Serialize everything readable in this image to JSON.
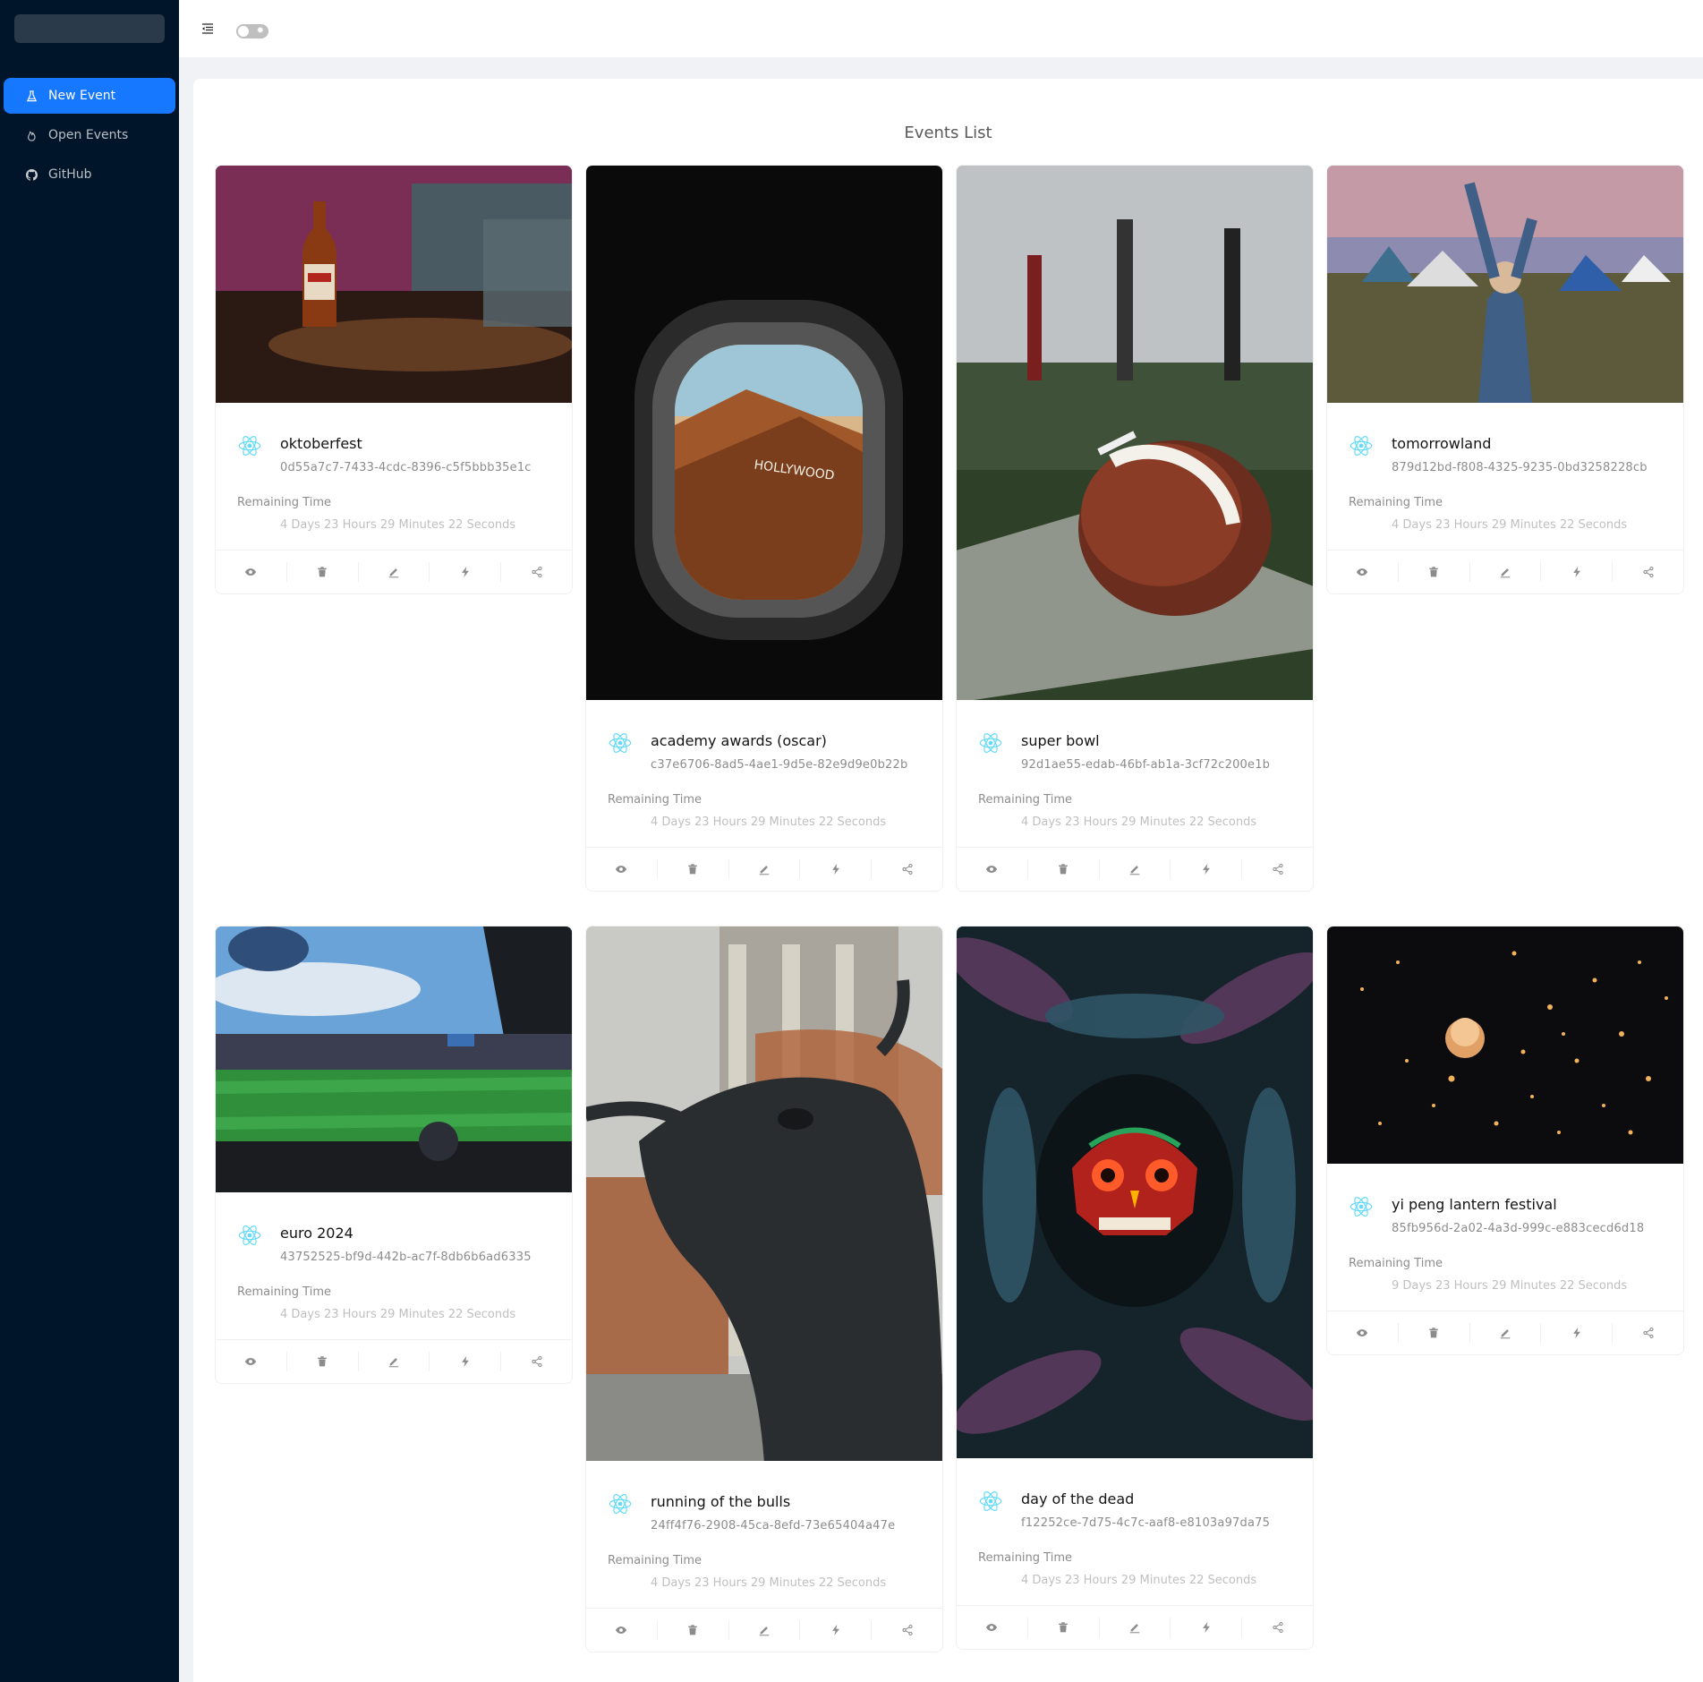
{
  "sidebar": {
    "items": [
      {
        "label": "New Event",
        "icon": "flask-icon",
        "active": true
      },
      {
        "label": "Open Events",
        "icon": "fire-icon",
        "active": false
      },
      {
        "label": "GitHub",
        "icon": "github-icon",
        "active": false
      }
    ]
  },
  "header": {
    "theme_toggle_icon": "sun-icon",
    "theme_dark": false
  },
  "page": {
    "title": "Events List"
  },
  "colors": {
    "accent": "#1677ff",
    "sider": "#001529",
    "react_icon": "#61dafb"
  },
  "events": [
    {
      "title": "oktoberfest",
      "id": "0d55a7c7-7433-4cdc-8396-c5f5bbb35e1c",
      "remaining_label": "Remaining Time",
      "remaining": "4 Days 23 Hours 29 Minutes 22 Seconds",
      "image": "beer-bottle-bar-photo"
    },
    {
      "title": "academy awards (oscar)",
      "id": "c37e6706-8ad5-4ae1-9d5e-82e9d9e0b22b",
      "remaining_label": "Remaining Time",
      "remaining": "4 Days 23 Hours 29 Minutes 22 Seconds",
      "image": "airplane-window-hollywood-photo"
    },
    {
      "title": "super bowl",
      "id": "92d1ae55-edab-46bf-ab1a-3cf72c200e1b",
      "remaining_label": "Remaining Time",
      "remaining": "4 Days 23 Hours 29 Minutes 22 Seconds",
      "image": "football-on-field-photo"
    },
    {
      "title": "tomorrowland",
      "id": "879d12bd-f808-4325-9235-0bd3258228cb",
      "remaining_label": "Remaining Time",
      "remaining": "4 Days 23 Hours 29 Minutes 22 Seconds",
      "image": "festival-camp-photo"
    },
    {
      "title": "euro 2024",
      "id": "43752525-bf9d-442b-ac7f-8db6b6ad6335",
      "remaining_label": "Remaining Time",
      "remaining": "4 Days 23 Hours 29 Minutes 22 Seconds",
      "image": "soccer-stadium-photo"
    },
    {
      "title": "running of the bulls",
      "id": "24ff4f76-2908-45ca-8efd-73e65404a47e",
      "remaining_label": "Remaining Time",
      "remaining": "4 Days 23 Hours 29 Minutes 22 Seconds",
      "image": "bull-statue-photo"
    },
    {
      "title": "day of the dead",
      "id": "f12252ce-7d75-4c7c-aaf8-e8103a97da75",
      "remaining_label": "Remaining Time",
      "remaining": "4 Days 23 Hours 29 Minutes 22 Seconds",
      "image": "sugar-skull-photo"
    },
    {
      "title": "yi peng lantern festival",
      "id": "85fb956d-2a02-4a3d-999c-e883cecd6d18",
      "remaining_label": "Remaining Time",
      "remaining": "9 Days 23 Hours 29 Minutes 22 Seconds",
      "image": "sky-lanterns-photo"
    }
  ],
  "card_actions": [
    {
      "name": "view",
      "icon": "eye-icon"
    },
    {
      "name": "delete",
      "icon": "delete-icon"
    },
    {
      "name": "edit",
      "icon": "edit-icon"
    },
    {
      "name": "trigger",
      "icon": "thunderbolt-icon"
    },
    {
      "name": "share",
      "icon": "share-icon"
    }
  ]
}
